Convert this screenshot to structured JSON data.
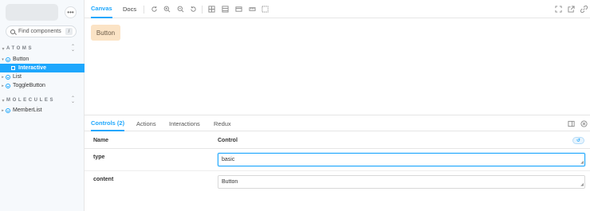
{
  "sidebar": {
    "menu_icon": "more-horizontal-icon",
    "search": {
      "placeholder": "Find components",
      "shortcut": "/"
    },
    "sections": [
      {
        "title": "ATOMS"
      },
      {
        "title": "MOLECULES"
      }
    ],
    "items": [
      {
        "label": "Button"
      },
      {
        "label": "Interactive"
      },
      {
        "label": "List"
      },
      {
        "label": "ToggleButton"
      },
      {
        "label": "MemberList"
      }
    ]
  },
  "toolbar": {
    "tabs": [
      {
        "label": "Canvas"
      },
      {
        "label": "Docs"
      }
    ],
    "tools": [
      "reload-icon",
      "zoom-in-icon",
      "zoom-out-icon",
      "zoom-reset-icon",
      "grid-icon",
      "background-icon",
      "viewport-icon",
      "measure-icon",
      "outline-icon"
    ],
    "right_tools": [
      "fullscreen-icon",
      "open-new-tab-icon",
      "copy-link-icon"
    ]
  },
  "preview": {
    "button_label": "Button"
  },
  "addons": {
    "tabs": [
      {
        "label": "Controls (2)"
      },
      {
        "label": "Actions"
      },
      {
        "label": "Interactions"
      },
      {
        "label": "Redux"
      }
    ],
    "table": {
      "col_name": "Name",
      "col_control": "Control",
      "rows": [
        {
          "name": "type",
          "value": "basic"
        },
        {
          "name": "content",
          "value": "Button"
        }
      ]
    }
  },
  "colors": {
    "accent": "#1ea7fd",
    "button_bg": "#fbe3c5"
  }
}
